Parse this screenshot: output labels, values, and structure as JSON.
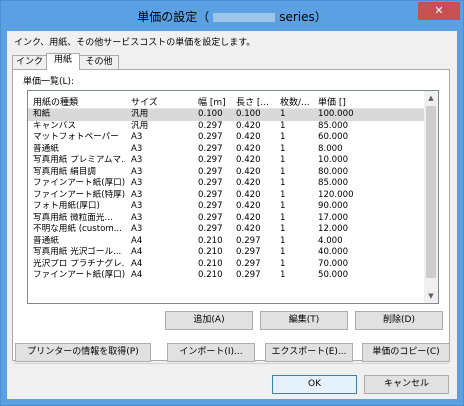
{
  "window": {
    "title_prefix": "単価の設定（",
    "title_suffix": "series）",
    "close_label": "✕"
  },
  "description": "インク、用紙、その他サービスコストの単価を設定します。",
  "tabs": [
    "インク",
    "用紙",
    "その他"
  ],
  "active_tab": "用紙",
  "list_label": "単価一覧(L):",
  "columns": [
    "用紙の種類",
    "サイズ",
    "幅 [m]",
    "長さ [...",
    "枚数/...",
    "単価 []"
  ],
  "rows": [
    [
      "和紙",
      "汎用",
      "0.100",
      "0.100",
      "1",
      "100.000"
    ],
    [
      "キャンバス",
      "汎用",
      "0.297",
      "0.420",
      "1",
      "85.000"
    ],
    [
      "マットフォトペーパー",
      "A3",
      "0.297",
      "0.420",
      "1",
      "60.000"
    ],
    [
      "普通紙",
      "A3",
      "0.297",
      "0.420",
      "1",
      "8.000"
    ],
    [
      "写真用紙 プレミアムマ...",
      "A3",
      "0.297",
      "0.420",
      "1",
      "10.000"
    ],
    [
      "写真用紙 絹目調",
      "A3",
      "0.297",
      "0.420",
      "1",
      "80.000"
    ],
    [
      "ファインアート紙(厚口)",
      "A3",
      "0.297",
      "0.420",
      "1",
      "85.000"
    ],
    [
      "ファインアート紙(特厚)",
      "A3",
      "0.297",
      "0.420",
      "1",
      "120.000"
    ],
    [
      "フォト用紙(厚口)",
      "A3",
      "0.297",
      "0.420",
      "1",
      "90.000"
    ],
    [
      "写真用紙 微粒面光...",
      "A3",
      "0.297",
      "0.420",
      "1",
      "17.000"
    ],
    [
      "不明な用紙 (custom...",
      "A3",
      "0.297",
      "0.420",
      "1",
      "12.000"
    ],
    [
      "普通紙",
      "A4",
      "0.210",
      "0.297",
      "1",
      "4.000"
    ],
    [
      "写真用紙 光沢ゴール...",
      "A4",
      "0.210",
      "0.297",
      "1",
      "40.000"
    ],
    [
      "光沢プロ プラチナグレ...",
      "A4",
      "0.210",
      "0.297",
      "1",
      "70.000"
    ],
    [
      "ファインアート紙(厚口)",
      "A4",
      "0.210",
      "0.297",
      "1",
      "50.000"
    ]
  ],
  "list_buttons": {
    "add": "追加(A)",
    "edit": "編集(T)",
    "delete": "削除(D)"
  },
  "action_buttons": {
    "get_printer_info": "プリンターの情報を取得(P)",
    "import": "インポート(I)...",
    "export": "エクスポート(E)...",
    "copy_price": "単価のコピー(C)"
  },
  "dialog_buttons": {
    "ok": "OK",
    "cancel": "キャンセル"
  }
}
